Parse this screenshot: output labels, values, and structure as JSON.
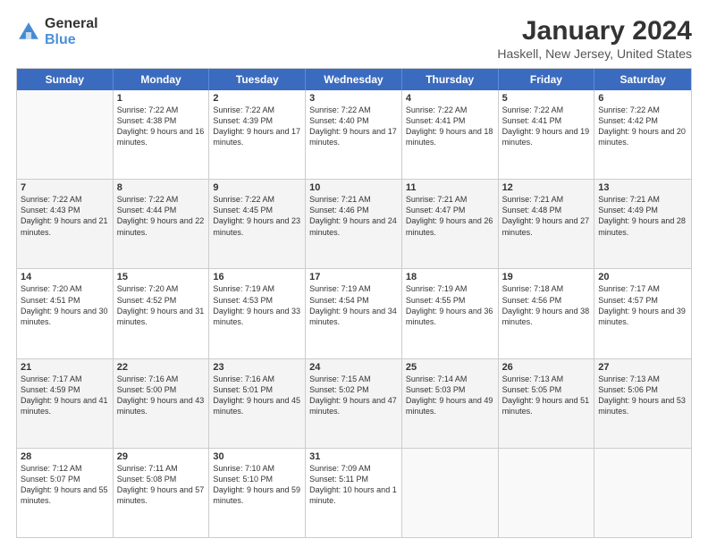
{
  "header": {
    "logo_general": "General",
    "logo_blue": "Blue",
    "title": "January 2024",
    "subtitle": "Haskell, New Jersey, United States"
  },
  "calendar": {
    "days": [
      "Sunday",
      "Monday",
      "Tuesday",
      "Wednesday",
      "Thursday",
      "Friday",
      "Saturday"
    ],
    "weeks": [
      [
        {
          "day": "",
          "info": ""
        },
        {
          "day": "1",
          "info": "Sunrise: 7:22 AM\nSunset: 4:38 PM\nDaylight: 9 hours\nand 16 minutes."
        },
        {
          "day": "2",
          "info": "Sunrise: 7:22 AM\nSunset: 4:39 PM\nDaylight: 9 hours\nand 17 minutes."
        },
        {
          "day": "3",
          "info": "Sunrise: 7:22 AM\nSunset: 4:40 PM\nDaylight: 9 hours\nand 17 minutes."
        },
        {
          "day": "4",
          "info": "Sunrise: 7:22 AM\nSunset: 4:41 PM\nDaylight: 9 hours\nand 18 minutes."
        },
        {
          "day": "5",
          "info": "Sunrise: 7:22 AM\nSunset: 4:41 PM\nDaylight: 9 hours\nand 19 minutes."
        },
        {
          "day": "6",
          "info": "Sunrise: 7:22 AM\nSunset: 4:42 PM\nDaylight: 9 hours\nand 20 minutes."
        }
      ],
      [
        {
          "day": "7",
          "info": "Sunrise: 7:22 AM\nSunset: 4:43 PM\nDaylight: 9 hours\nand 21 minutes."
        },
        {
          "day": "8",
          "info": "Sunrise: 7:22 AM\nSunset: 4:44 PM\nDaylight: 9 hours\nand 22 minutes."
        },
        {
          "day": "9",
          "info": "Sunrise: 7:22 AM\nSunset: 4:45 PM\nDaylight: 9 hours\nand 23 minutes."
        },
        {
          "day": "10",
          "info": "Sunrise: 7:21 AM\nSunset: 4:46 PM\nDaylight: 9 hours\nand 24 minutes."
        },
        {
          "day": "11",
          "info": "Sunrise: 7:21 AM\nSunset: 4:47 PM\nDaylight: 9 hours\nand 26 minutes."
        },
        {
          "day": "12",
          "info": "Sunrise: 7:21 AM\nSunset: 4:48 PM\nDaylight: 9 hours\nand 27 minutes."
        },
        {
          "day": "13",
          "info": "Sunrise: 7:21 AM\nSunset: 4:49 PM\nDaylight: 9 hours\nand 28 minutes."
        }
      ],
      [
        {
          "day": "14",
          "info": "Sunrise: 7:20 AM\nSunset: 4:51 PM\nDaylight: 9 hours\nand 30 minutes."
        },
        {
          "day": "15",
          "info": "Sunrise: 7:20 AM\nSunset: 4:52 PM\nDaylight: 9 hours\nand 31 minutes."
        },
        {
          "day": "16",
          "info": "Sunrise: 7:19 AM\nSunset: 4:53 PM\nDaylight: 9 hours\nand 33 minutes."
        },
        {
          "day": "17",
          "info": "Sunrise: 7:19 AM\nSunset: 4:54 PM\nDaylight: 9 hours\nand 34 minutes."
        },
        {
          "day": "18",
          "info": "Sunrise: 7:19 AM\nSunset: 4:55 PM\nDaylight: 9 hours\nand 36 minutes."
        },
        {
          "day": "19",
          "info": "Sunrise: 7:18 AM\nSunset: 4:56 PM\nDaylight: 9 hours\nand 38 minutes."
        },
        {
          "day": "20",
          "info": "Sunrise: 7:17 AM\nSunset: 4:57 PM\nDaylight: 9 hours\nand 39 minutes."
        }
      ],
      [
        {
          "day": "21",
          "info": "Sunrise: 7:17 AM\nSunset: 4:59 PM\nDaylight: 9 hours\nand 41 minutes."
        },
        {
          "day": "22",
          "info": "Sunrise: 7:16 AM\nSunset: 5:00 PM\nDaylight: 9 hours\nand 43 minutes."
        },
        {
          "day": "23",
          "info": "Sunrise: 7:16 AM\nSunset: 5:01 PM\nDaylight: 9 hours\nand 45 minutes."
        },
        {
          "day": "24",
          "info": "Sunrise: 7:15 AM\nSunset: 5:02 PM\nDaylight: 9 hours\nand 47 minutes."
        },
        {
          "day": "25",
          "info": "Sunrise: 7:14 AM\nSunset: 5:03 PM\nDaylight: 9 hours\nand 49 minutes."
        },
        {
          "day": "26",
          "info": "Sunrise: 7:13 AM\nSunset: 5:05 PM\nDaylight: 9 hours\nand 51 minutes."
        },
        {
          "day": "27",
          "info": "Sunrise: 7:13 AM\nSunset: 5:06 PM\nDaylight: 9 hours\nand 53 minutes."
        }
      ],
      [
        {
          "day": "28",
          "info": "Sunrise: 7:12 AM\nSunset: 5:07 PM\nDaylight: 9 hours\nand 55 minutes."
        },
        {
          "day": "29",
          "info": "Sunrise: 7:11 AM\nSunset: 5:08 PM\nDaylight: 9 hours\nand 57 minutes."
        },
        {
          "day": "30",
          "info": "Sunrise: 7:10 AM\nSunset: 5:10 PM\nDaylight: 9 hours\nand 59 minutes."
        },
        {
          "day": "31",
          "info": "Sunrise: 7:09 AM\nSunset: 5:11 PM\nDaylight: 10 hours\nand 1 minute."
        },
        {
          "day": "",
          "info": ""
        },
        {
          "day": "",
          "info": ""
        },
        {
          "day": "",
          "info": ""
        }
      ]
    ]
  }
}
